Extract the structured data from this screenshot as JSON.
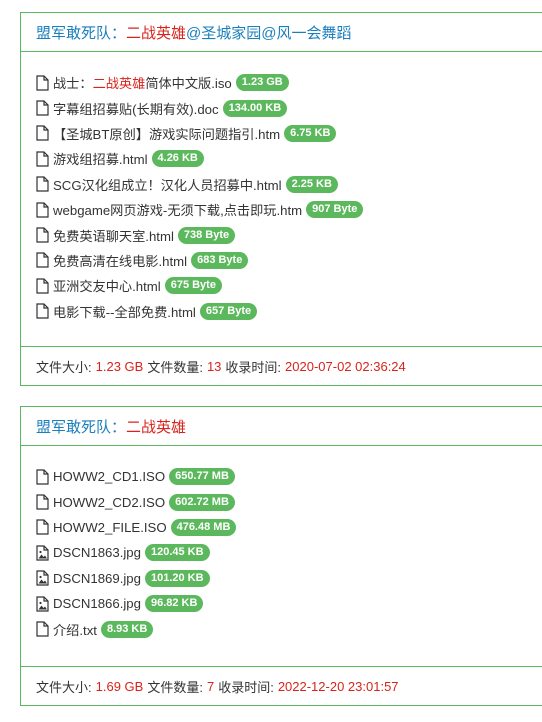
{
  "colors": {
    "accent": "#5cb85c",
    "title": "#1a7fbd",
    "highlight": "#d9231c"
  },
  "panels": [
    {
      "title_prefix": "盟军敢死队：",
      "title_highlight": "二战英雄",
      "title_suffix": "@圣城家园@风一会舞蹈",
      "files": [
        {
          "icon": "file-icon",
          "pre": "战士：",
          "hl": "二战英雄",
          "post": "简体中文版.iso",
          "size": "1.23 GB"
        },
        {
          "icon": "file-icon",
          "pre": "字幕组招募贴(长期有效).doc",
          "hl": "",
          "post": "",
          "size": "134.00 KB"
        },
        {
          "icon": "file-icon",
          "pre": "【圣城BT原创】游戏实际问题指引.htm",
          "hl": "",
          "post": "",
          "size": "6.75 KB"
        },
        {
          "icon": "file-icon",
          "pre": "游戏组招募.html",
          "hl": "",
          "post": "",
          "size": "4.26 KB"
        },
        {
          "icon": "file-icon",
          "pre": "SCG汉化组成立！汉化人员招募中.html",
          "hl": "",
          "post": "",
          "size": "2.25 KB"
        },
        {
          "icon": "file-icon",
          "pre": "webgame网页游戏-无须下载,点击即玩.htm",
          "hl": "",
          "post": "",
          "size": "907 Byte"
        },
        {
          "icon": "file-icon",
          "pre": "免费英语聊天室.html",
          "hl": "",
          "post": "",
          "size": "738 Byte"
        },
        {
          "icon": "file-icon",
          "pre": "免费高清在线电影.html",
          "hl": "",
          "post": "",
          "size": "683 Byte"
        },
        {
          "icon": "file-icon",
          "pre": "亚洲交友中心.html",
          "hl": "",
          "post": "",
          "size": "675 Byte"
        },
        {
          "icon": "file-icon",
          "pre": "电影下载--全部免费.html",
          "hl": "",
          "post": "",
          "size": "657 Byte"
        }
      ],
      "footer": {
        "size_label": "文件大小:",
        "size_value": "1.23 GB",
        "count_label": "文件数量:",
        "count_value": "13",
        "time_label": "收录时间:",
        "time_value": "2020-07-02 02:36:24"
      }
    },
    {
      "title_prefix": "盟军敢死队：",
      "title_highlight": "二战英雄",
      "title_suffix": "",
      "files": [
        {
          "icon": "file-icon",
          "pre": "HOWW2_CD1.ISO",
          "hl": "",
          "post": "",
          "size": "650.77 MB"
        },
        {
          "icon": "file-icon",
          "pre": "HOWW2_CD2.ISO",
          "hl": "",
          "post": "",
          "size": "602.72 MB"
        },
        {
          "icon": "file-icon",
          "pre": "HOWW2_FILE.ISO",
          "hl": "",
          "post": "",
          "size": "476.48 MB"
        },
        {
          "icon": "image-file-icon",
          "pre": "DSCN1863.jpg",
          "hl": "",
          "post": "",
          "size": "120.45 KB"
        },
        {
          "icon": "image-file-icon",
          "pre": "DSCN1869.jpg",
          "hl": "",
          "post": "",
          "size": "101.20 KB"
        },
        {
          "icon": "image-file-icon",
          "pre": "DSCN1866.jpg",
          "hl": "",
          "post": "",
          "size": "96.82 KB"
        },
        {
          "icon": "file-icon",
          "pre": "介绍.txt",
          "hl": "",
          "post": "",
          "size": "8.93 KB"
        }
      ],
      "footer": {
        "size_label": "文件大小:",
        "size_value": "1.69 GB",
        "count_label": "文件数量:",
        "count_value": "7",
        "time_label": "收录时间:",
        "time_value": "2022-12-20 23:01:57"
      }
    }
  ]
}
